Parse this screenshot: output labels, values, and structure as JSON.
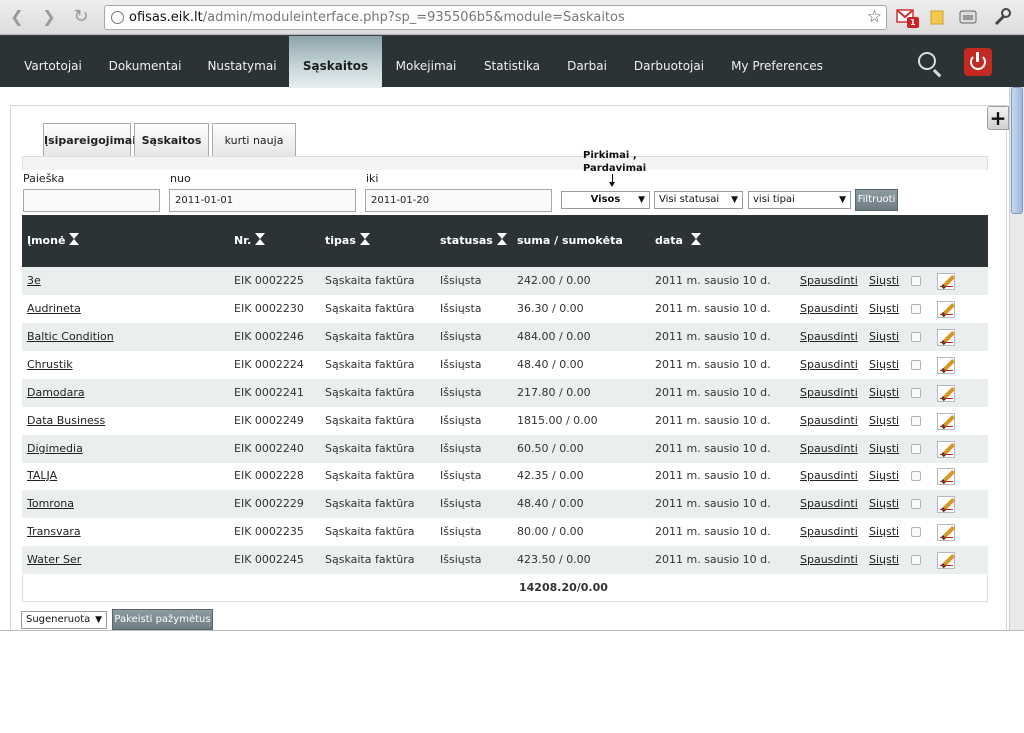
{
  "browser": {
    "url_host": "ofisas.eik.lt",
    "url_path": "/admin/moduleinterface.php?sp_=935506b5&module=Saskaitos",
    "gmail_badge": "1"
  },
  "nav": {
    "items": [
      {
        "label": "Vartotojai"
      },
      {
        "label": "Dokumentai"
      },
      {
        "label": "Nustatymai"
      },
      {
        "label": "Sąskaitos"
      },
      {
        "label": "Mokejimai"
      },
      {
        "label": "Statistika"
      },
      {
        "label": "Darbai"
      },
      {
        "label": "Darbuotojai"
      },
      {
        "label": "My Preferences"
      }
    ]
  },
  "tabs": [
    {
      "label": "Įsipareigojimai"
    },
    {
      "label": "Sąskaitos"
    },
    {
      "label": "kurti nauja"
    }
  ],
  "filters": {
    "search_label": "Paieška",
    "search_value": "",
    "from_label": "nuo",
    "from_value": "2011-01-01",
    "to_label": "iki",
    "to_value": "2011-01-20",
    "tooltip_line1": "Pirkimai ,",
    "tooltip_line2": "Pardavimai",
    "type_select": "Visos",
    "status_select": "Visi statusai",
    "kind_select": "visi tipai",
    "filter_button": "Filtruoti"
  },
  "table": {
    "headers": {
      "company": "Įmonė",
      "number": "Nr.",
      "type": "tipas",
      "status": "statusas",
      "amount": "suma / sumokėta",
      "date": "data"
    },
    "print_label": "Spausdinti",
    "send_label": "Siųsti",
    "rows": [
      {
        "company": "3e",
        "number": "EIK 0002225",
        "type": "Sąskaita faktūra",
        "status": "Išsiųsta",
        "amount": "242.00 / 0.00",
        "date": "2011 m. sausio 10 d."
      },
      {
        "company": "Audrineta",
        "number": "EIK 0002230",
        "type": "Sąskaita faktūra",
        "status": "Išsiųsta",
        "amount": "36.30 / 0.00",
        "date": "2011 m. sausio 10 d."
      },
      {
        "company": "Baltic Condition",
        "number": "EIK 0002246",
        "type": "Sąskaita faktūra",
        "status": "Išsiųsta",
        "amount": "484.00 / 0.00",
        "date": "2011 m. sausio 10 d."
      },
      {
        "company": "Chrustik",
        "number": "EIK 0002224",
        "type": "Sąskaita faktūra",
        "status": "Išsiųsta",
        "amount": "48.40 / 0.00",
        "date": "2011 m. sausio 10 d."
      },
      {
        "company": "Damodara",
        "number": "EIK 0002241",
        "type": "Sąskaita faktūra",
        "status": "Išsiųsta",
        "amount": "217.80 / 0.00",
        "date": "2011 m. sausio 10 d."
      },
      {
        "company": "Data Business",
        "number": "EIK 0002249",
        "type": "Sąskaita faktūra",
        "status": "Išsiųsta",
        "amount": "1815.00 / 0.00",
        "date": "2011 m. sausio 10 d."
      },
      {
        "company": "Digimedia",
        "number": "EIK 0002240",
        "type": "Sąskaita faktūra",
        "status": "Išsiųsta",
        "amount": "60.50 / 0.00",
        "date": "2011 m. sausio 10 d."
      },
      {
        "company": "TALJA",
        "number": "EIK 0002228",
        "type": "Sąskaita faktūra",
        "status": "Išsiųsta",
        "amount": "42.35 / 0.00",
        "date": "2011 m. sausio 10 d."
      },
      {
        "company": "Tomrona",
        "number": "EIK 0002229",
        "type": "Sąskaita faktūra",
        "status": "Išsiųsta",
        "amount": "48.40 / 0.00",
        "date": "2011 m. sausio 10 d."
      },
      {
        "company": "Transvara",
        "number": "EIK 0002235",
        "type": "Sąskaita faktūra",
        "status": "Išsiųsta",
        "amount": "80.00 / 0.00",
        "date": "2011 m. sausio 10 d."
      },
      {
        "company": "Water Ser",
        "number": "EIK 0002245",
        "type": "Sąskaita faktūra",
        "status": "Išsiųsta",
        "amount": "423.50 / 0.00",
        "date": "2011 m. sausio 10 d."
      }
    ],
    "total": "14208.20/0.00"
  },
  "bulk": {
    "status_select": "Sugeneruota",
    "apply_button": "Pakeisti pažymėtus"
  }
}
